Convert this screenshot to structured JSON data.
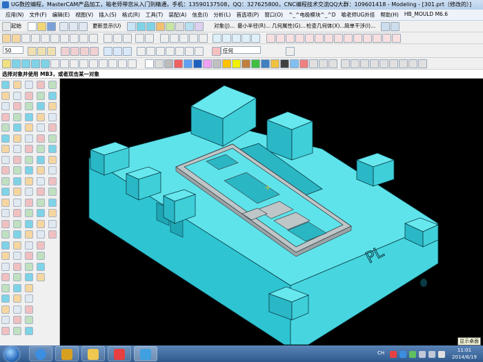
{
  "titlebar": {
    "title": "UG数控编程，MasterCAM产品加工，喻老师带您从入门到精通，手机：13590137508，QQ：327625800，CNC编程技术交流QQ大群：109601418 - Modeling - [301.prt（修改的）]"
  },
  "menubar": {
    "items": [
      "应用(N)",
      "文件(F)",
      "编辑(E)",
      "视图(V)",
      "插入(S)",
      "格式(R)",
      "工具(T)",
      "装配(A)",
      "信息(I)",
      "分析(L)",
      "首选项(P)",
      "窗口(O)",
      "^_^电极模块^_^D",
      "喻老师UG外挂",
      "帮助(H)",
      "HB_MOULD M6.6"
    ]
  },
  "toolbar1": {
    "start_label": "起始",
    "show_more_label": "更新显示(U)",
    "object_label": "对象(J)...",
    "min_radius_label": "最小半径(R)...",
    "geom_props_label": "几何属性(G)...",
    "check_geom_label": "检查几何体(X)...",
    "simple_interference_label": "简单干涉(I)..."
  },
  "toolbar2": {
    "grid_value": "50",
    "snap_filter_value": "任何"
  },
  "statusline": {
    "prompt": "选择对象并使用 MB3，或者双击某一对象"
  },
  "viewport": {
    "engraved_text": "PL",
    "colors": {
      "mold_top": "#5fe3ea",
      "mold_left": "#2ec4d2",
      "mold_right": "#47d6e0",
      "edge": "#0a3a44",
      "background": "#000000"
    }
  },
  "taskbar": {
    "tray_lang": "CH",
    "time": "11:01",
    "date": "2014/6/19",
    "show_desktop_tooltip": "显示桌面"
  }
}
